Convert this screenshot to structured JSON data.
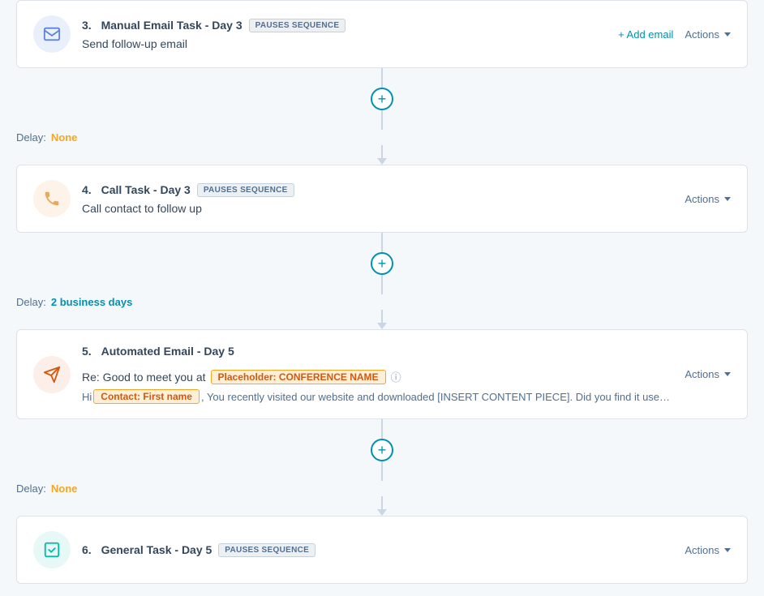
{
  "steps": [
    {
      "id": "step3",
      "number": "3.",
      "type": "Manual Email Task",
      "day": "Day 3",
      "badge": "PAUSES SEQUENCE",
      "subtitle": "Send follow-up email",
      "icon_type": "email",
      "has_add_email": true,
      "actions_label": "Actions"
    },
    {
      "id": "step4",
      "number": "4.",
      "type": "Call Task",
      "day": "Day 3",
      "badge": "PAUSES SEQUENCE",
      "subtitle": "Call contact to follow up",
      "icon_type": "call",
      "has_add_email": false,
      "actions_label": "Actions"
    },
    {
      "id": "step5",
      "number": "5.",
      "type": "Automated Email",
      "day": "Day 5",
      "badge": null,
      "icon_type": "automated-email",
      "has_add_email": false,
      "actions_label": "Actions",
      "email": {
        "subject_prefix": "Re: Good to meet you at",
        "placeholder_text": "Placeholder: CONFERENCE NAME",
        "body_start": "Hi",
        "contact_token": "Contact: First name",
        "body_rest": ", You recently visited our website and downloaded [INSERT CONTENT PIECE]. Did you find it use…"
      }
    },
    {
      "id": "step6",
      "number": "6.",
      "type": "General Task",
      "day": "Day 5",
      "badge": "PAUSES SEQUENCE",
      "subtitle": "",
      "icon_type": "task",
      "has_add_email": false,
      "actions_label": "Actions"
    }
  ],
  "connectors": [
    {
      "id": "conn1",
      "delay_label": "Delay:",
      "delay_value": "None",
      "delay_type": "none"
    },
    {
      "id": "conn2",
      "delay_label": "Delay:",
      "delay_value": "2 business days",
      "delay_type": "days"
    },
    {
      "id": "conn3",
      "delay_label": "Delay:",
      "delay_value": "None",
      "delay_type": "none"
    }
  ],
  "add_email_label": "+ Add email",
  "add_step_symbol": "+",
  "info_symbol": "ⓘ"
}
